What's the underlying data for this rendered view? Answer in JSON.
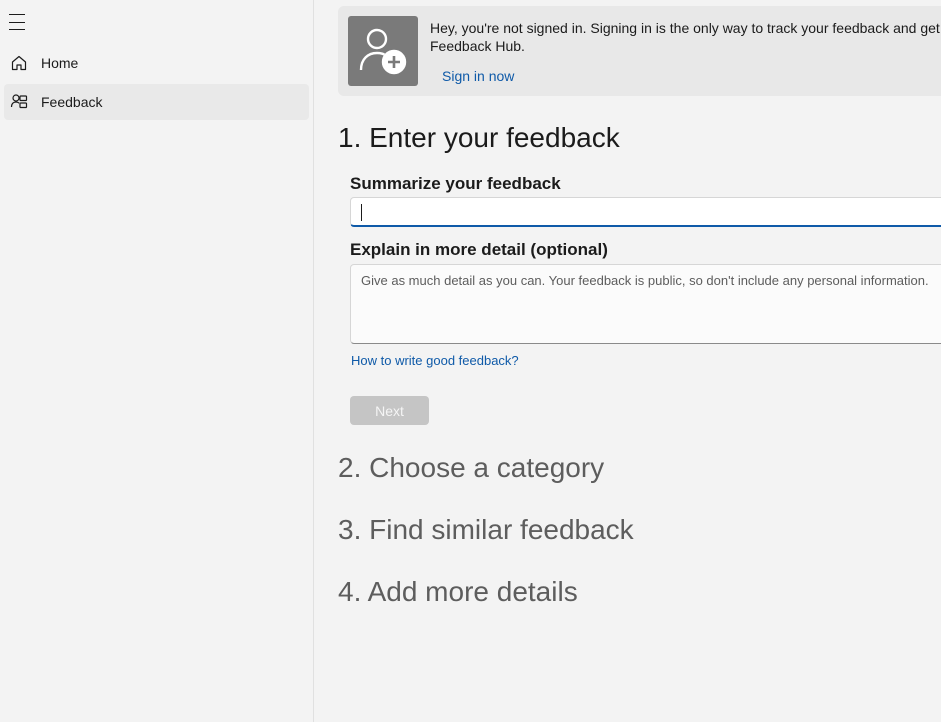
{
  "sidebar": {
    "menu_icon": "hamburger-menu-icon",
    "items": [
      {
        "label": "Home",
        "icon": "home-icon"
      },
      {
        "label": "Feedback",
        "icon": "feedback-icon",
        "selected": true
      }
    ]
  },
  "banner": {
    "icon": "add-user-icon",
    "message": "Hey, you're not signed in. Signing in is the only way to track your feedback and get Feedback Hub.",
    "sign_in_label": "Sign in now"
  },
  "steps": [
    {
      "label": "1. Enter your feedback",
      "active": true
    },
    {
      "label": "2. Choose a category",
      "active": false
    },
    {
      "label": "3. Find similar feedback",
      "active": false
    },
    {
      "label": "4. Add more details",
      "active": false
    }
  ],
  "form": {
    "summary_label": "Summarize your feedback",
    "summary_value": "",
    "detail_label": "Explain in more detail (optional)",
    "detail_placeholder": "Give as much detail as you can. Your feedback is public, so don't include any personal information.",
    "howto_link": "How to write good feedback?",
    "next_label": "Next"
  },
  "colors": {
    "accent": "#0f5aa8",
    "background": "#f3f3f3",
    "disabled_button": "#c5c5c5"
  }
}
